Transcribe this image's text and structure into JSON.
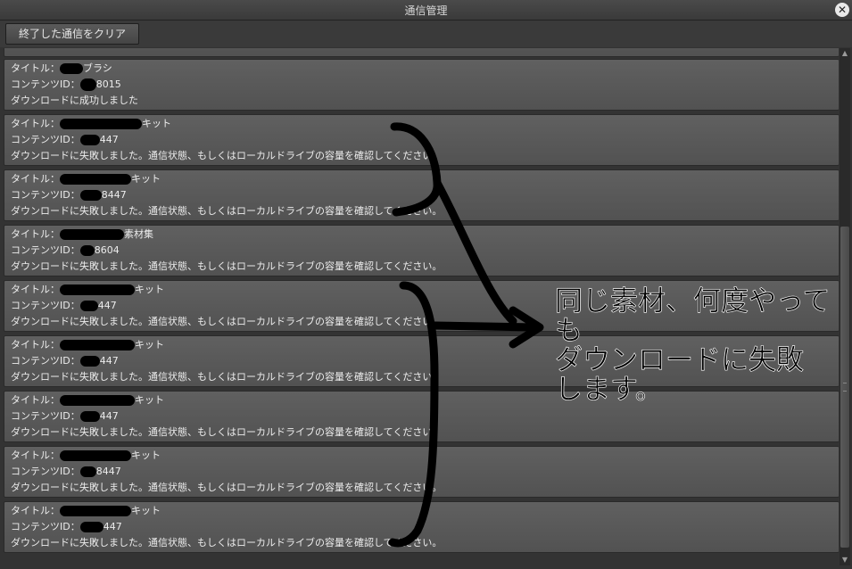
{
  "window": {
    "title": "通信管理"
  },
  "toolbar": {
    "clear_label": "終了した通信をクリア"
  },
  "rows": [
    {
      "title": "タイトル：",
      "title_suffix": "ブラシ",
      "id_label": "コンテンツID：",
      "id_suffix": "8015",
      "status": "ダウンロードに成功しました"
    },
    {
      "title": "タイトル：",
      "title_suffix": "キット",
      "id_label": "コンテンツID：",
      "id_suffix": "447",
      "status": "ダウンロードに失敗しました。通信状態、もしくはローカルドライブの容量を確認してください。"
    },
    {
      "title": "タイトル：",
      "title_suffix": "キット",
      "id_label": "コンテンツID：",
      "id_suffix": "8447",
      "status": "ダウンロードに失敗しました。通信状態、もしくはローカルドライブの容量を確認してください。"
    },
    {
      "title": "タイトル：",
      "title_suffix": "素材集",
      "id_label": "コンテンツID：",
      "id_suffix": "8604",
      "status": "ダウンロードに失敗しました。通信状態、もしくはローカルドライブの容量を確認してください。"
    },
    {
      "title": "タイトル：",
      "title_suffix": "キット",
      "id_label": "コンテンツID：",
      "id_suffix": "447",
      "status": "ダウンロードに失敗しました。通信状態、もしくはローカルドライブの容量を確認してください。"
    },
    {
      "title": "タイトル：",
      "title_suffix": "キット",
      "id_label": "コンテンツID：",
      "id_suffix": "447",
      "status": "ダウンロードに失敗しました。通信状態、もしくはローカルドライブの容量を確認してください。"
    },
    {
      "title": "タイトル：",
      "title_suffix": "キット",
      "id_label": "コンテンツID：",
      "id_suffix": "447",
      "status": "ダウンロードに失敗しました。通信状態、もしくはローカルドライブの容量を確認してください。"
    },
    {
      "title": "タイトル：",
      "title_suffix": "キット",
      "id_label": "コンテンツID：",
      "id_suffix": "8447",
      "status": "ダウンロードに失敗しました。通信状態、もしくはローカルドライブの容量を確認してください。"
    },
    {
      "title": "タイトル：",
      "title_suffix": "キット",
      "id_label": "コンテンツID：",
      "id_suffix": "447",
      "status": "ダウンロードに失敗しました。通信状態、もしくはローカルドライブの容量を確認してください。"
    }
  ],
  "annotation": {
    "line1": "同じ素材、何度やっても",
    "line2": "ダウンロードに失敗",
    "line3": "します。"
  },
  "icons": {
    "close": "close-icon",
    "scroll_up": "arrow-up-icon",
    "scroll_down": "arrow-down-icon"
  }
}
